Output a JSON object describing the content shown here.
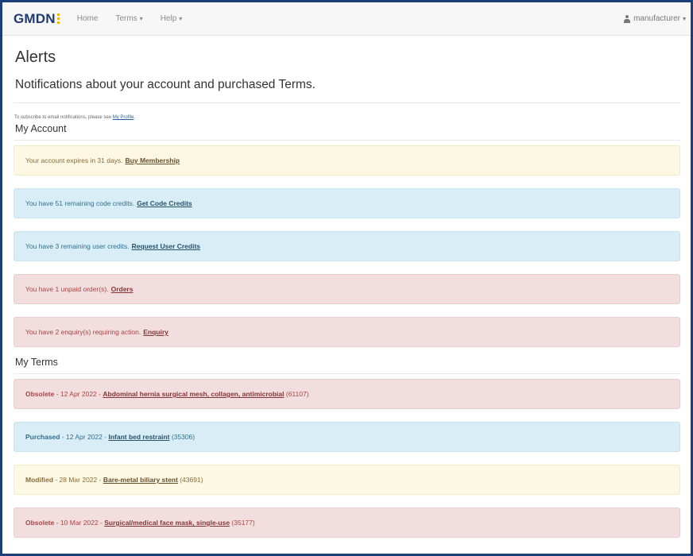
{
  "nav": {
    "logo": "GMDN",
    "items": [
      {
        "label": "Home",
        "dropdown": false
      },
      {
        "label": "Terms",
        "dropdown": true
      },
      {
        "label": "Help",
        "dropdown": true
      }
    ],
    "user": "manufacturer"
  },
  "page": {
    "title": "Alerts",
    "subtitle": "Notifications about your account and purchased Terms.",
    "subscribe_text": "To subscribe to email notifications, please see",
    "subscribe_link": "My Profile",
    "subscribe_end": "."
  },
  "my_account": {
    "heading": "My Account",
    "alerts": [
      {
        "type": "warning",
        "text": "Your account expires in 31 days.",
        "link": "Buy Membership"
      },
      {
        "type": "info",
        "text": "You have 51 remaining code credits.",
        "link": "Get Code Credits"
      },
      {
        "type": "info",
        "text": "You have 3 remaining user credits.",
        "link": "Request User Credits"
      },
      {
        "type": "danger",
        "text": "You have 1 unpaid order(s).",
        "link": "Orders"
      },
      {
        "type": "danger",
        "text": "You have 2 enquiry(s) requiring action.",
        "link": "Enquiry"
      }
    ]
  },
  "my_terms": {
    "heading": "My Terms",
    "items": [
      {
        "type": "danger",
        "status": "Obsolete",
        "date": "- 12 Apr 2022 -",
        "term": "Abdominal hernia surgical mesh, collagen, antimicrobial",
        "code": "(61107)"
      },
      {
        "type": "info",
        "status": "Purchased",
        "date": "- 12 Apr 2022 -",
        "term": "Infant bed restraint",
        "code": "(35306)"
      },
      {
        "type": "warning",
        "status": "Modified",
        "date": "- 28 Mar 2022 -",
        "term": "Bare-metal biliary stent",
        "code": "(43691)"
      },
      {
        "type": "danger",
        "status": "Obsolete",
        "date": "- 10 Mar 2022 -",
        "term": "Surgical/medical face mask, single-use",
        "code": "(35177)"
      }
    ]
  }
}
